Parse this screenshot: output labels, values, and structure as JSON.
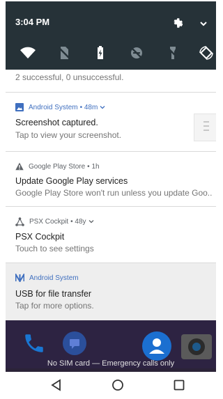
{
  "status_bar": {
    "time": "3:04 PM"
  },
  "quick_settings": {
    "icons": [
      "wifi-icon",
      "sim-off-icon",
      "battery-charging-icon",
      "do-not-disturb-off-icon",
      "flashlight-off-icon",
      "auto-rotate-icon"
    ]
  },
  "notifications": [
    {
      "body": "2 successful, 0 unsuccessful."
    },
    {
      "app": "Android System",
      "time": "• 48m",
      "title": "Screenshot captured.",
      "body": "Tap to view your screenshot.",
      "accent": "#3f6fbf"
    },
    {
      "app": "Google Play Store",
      "time": "• 1h",
      "title": "Update Google Play services",
      "body": "Google Play Store won't run unless you update Goo..",
      "accent": "#5f6368"
    },
    {
      "app": "PSX Cockpit",
      "time": "• 48y",
      "title": "PSX Cockpit",
      "body": "Touch to see settings",
      "accent": "#5f6368"
    },
    {
      "app": "Android System",
      "title": "USB for file transfer",
      "body": "Tap for more options.",
      "accent": "#3f6fbf"
    }
  ],
  "lockscreen": {
    "emergency_text": "No SIM card — Emergency calls only"
  },
  "nav_bar": {
    "buttons": [
      "back-icon",
      "home-icon",
      "recents-icon"
    ]
  }
}
